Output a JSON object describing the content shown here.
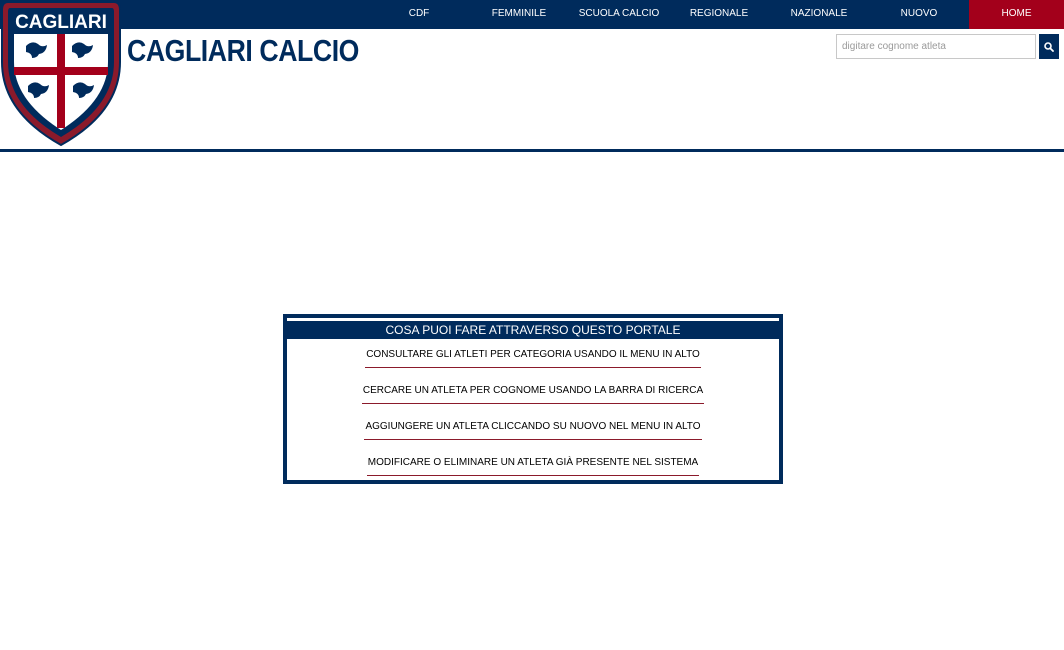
{
  "nav": {
    "items": [
      {
        "label": "CDF"
      },
      {
        "label": "FEMMINILE"
      },
      {
        "label": "SCUOLA CALCIO"
      },
      {
        "label": "REGIONALE"
      },
      {
        "label": "NAZIONALE"
      },
      {
        "label": "NUOVO"
      },
      {
        "label": "HOME",
        "active": true
      }
    ]
  },
  "brand": {
    "crest_text": "CAGLIARI",
    "name": "CAGLIARI CALCIO"
  },
  "search": {
    "value": "",
    "placeholder": "digitare cognome atleta",
    "button_icon": "search-icon"
  },
  "panel": {
    "title": "COSA PUOI FARE ATTRAVERSO QUESTO PORTALE",
    "items": [
      "CONSULTARE GLI ATLETI PER CATEGORIA USANDO IL MENU IN ALTO",
      "CERCARE UN ATLETA PER COGNOME USANDO LA BARRA DI RICERCA",
      "AGGIUNGERE UN ATLETA CLICCANDO SU NUOVO NEL MENU IN ALTO",
      "MODIFICARE O ELIMINARE UN ATLETA GIÀ PRESENTE NEL SISTEMA"
    ]
  },
  "colors": {
    "navy": "#002b5c",
    "red": "#a3001b",
    "divider": "#8b1a2b"
  }
}
